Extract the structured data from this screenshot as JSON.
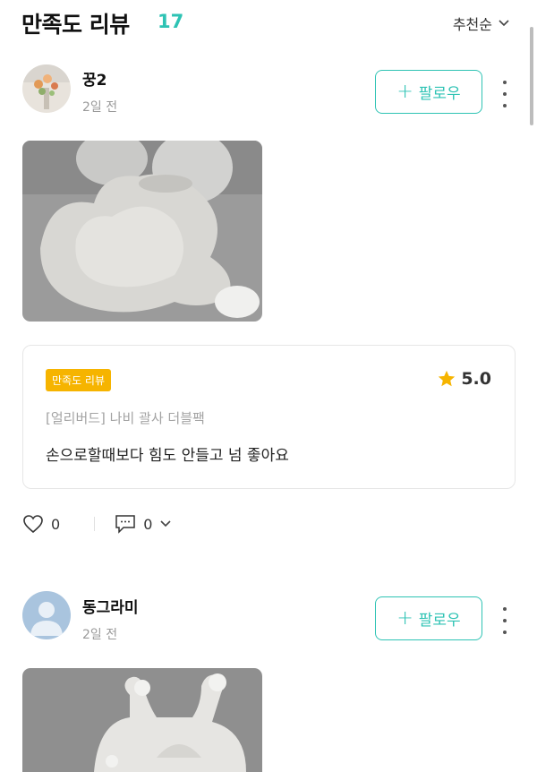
{
  "header": {
    "title": "만족도 리뷰",
    "count": "17",
    "sort_label": "추천순"
  },
  "reviews": [
    {
      "username": "꿍2",
      "date": "2일 전",
      "follow_label": "팔로우",
      "badge": "만족도 리뷰",
      "rating": "5.0",
      "product": "[얼리버드] 나비 괄사 더블팩",
      "text": "손으로할때보다 힘도 안들고 넘 좋아요",
      "likes": "0",
      "comments": "0"
    },
    {
      "username": "동그라미",
      "date": "2일 전",
      "follow_label": "팔로우"
    }
  ],
  "colors": {
    "accent": "#2ec3b4",
    "badge": "#f6b400",
    "star": "#f6b400"
  }
}
